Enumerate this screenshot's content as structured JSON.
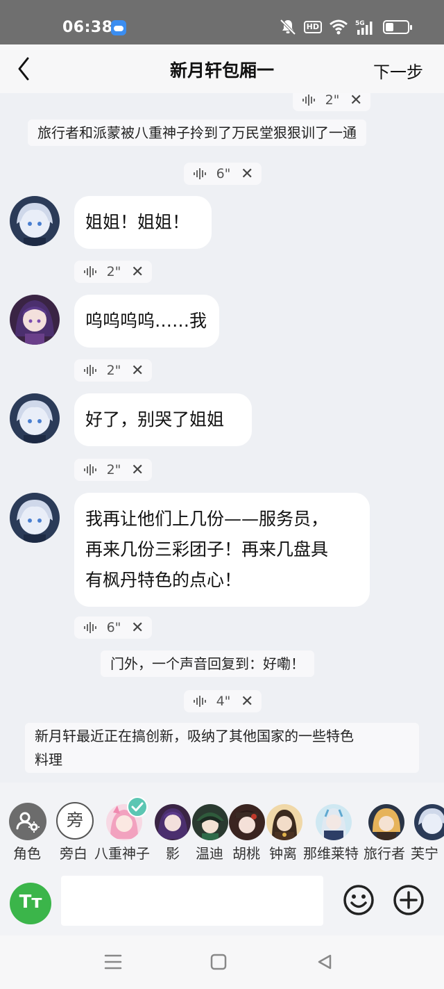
{
  "status_bar": {
    "time": "06:38",
    "network": "5G"
  },
  "header": {
    "title": "新月轩包厢一",
    "next_label": "下一步"
  },
  "messages": [
    {
      "type": "voice",
      "duration": "2\""
    },
    {
      "type": "narration",
      "text": "旅行者和派蒙被八重神子拎到了万民堂狠狠训了一通"
    },
    {
      "type": "voice",
      "duration": "6\""
    },
    {
      "type": "bubble",
      "speaker": "furina",
      "lines": [
        "姐姐！姐姐！"
      ]
    },
    {
      "type": "voice",
      "duration": "2\""
    },
    {
      "type": "bubble",
      "speaker": "raiden",
      "lines": [
        "呜呜呜呜……我"
      ]
    },
    {
      "type": "voice",
      "duration": "2\""
    },
    {
      "type": "bubble",
      "speaker": "furina",
      "lines": [
        "好了，别哭了姐姐"
      ]
    },
    {
      "type": "voice",
      "duration": "2\""
    },
    {
      "type": "bubble",
      "speaker": "furina",
      "lines": [
        "我再让他们上几份——服务员，",
        "再来几份三彩团子！再来几盘具",
        "有枫丹特色的点心！"
      ]
    },
    {
      "type": "voice",
      "duration": "6\""
    },
    {
      "type": "narration",
      "text": "门外，一个声音回复到：好嘞！"
    },
    {
      "type": "voice",
      "duration": "4\""
    },
    {
      "type": "narration",
      "lines": [
        "新月轩最近正在搞创新，吸纳了其他国家的一些特色",
        "料理"
      ]
    }
  ],
  "characters": [
    {
      "label": "角色",
      "icon": "role-settings-icon"
    },
    {
      "label": "旁白",
      "icon": "narrator-icon",
      "glyph": "旁"
    },
    {
      "label": "八重神子",
      "selected": true
    },
    {
      "label": "影"
    },
    {
      "label": "温迪"
    },
    {
      "label": "胡桃"
    },
    {
      "label": "钟离"
    },
    {
      "label": "那维莱特"
    },
    {
      "label": "旅行者"
    },
    {
      "label": "芙宁"
    }
  ],
  "input": {
    "tt_label": "Tт",
    "placeholder": ""
  },
  "colors": {
    "accent_green": "#3bb54a",
    "status_bar": "#6f6f6f",
    "background": "#eef0f4",
    "check_teal": "#5cc6b3"
  }
}
